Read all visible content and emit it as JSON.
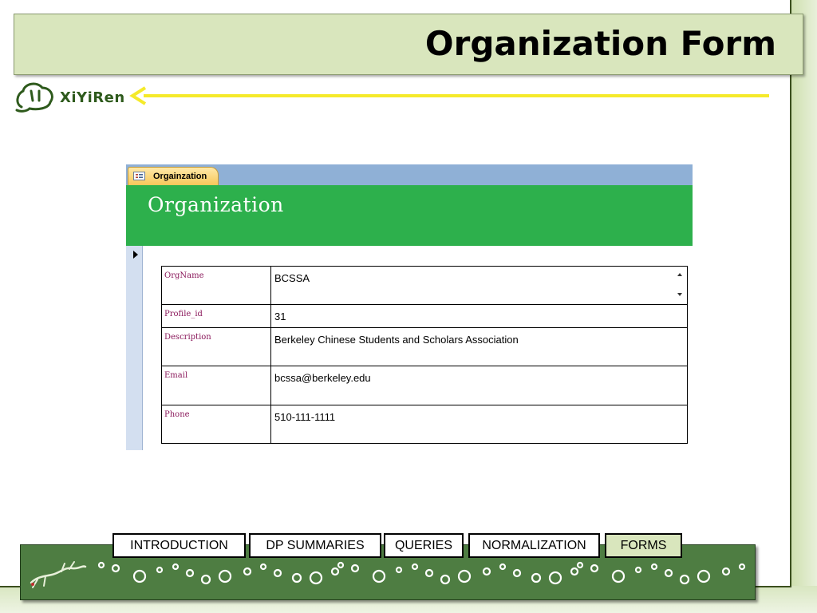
{
  "slide": {
    "title": "Organization Form",
    "logo_text": "XiYiRen"
  },
  "access_form": {
    "tab_label": "Orgainzation",
    "header_title": "Organization",
    "fields": [
      {
        "label": "OrgName",
        "value": "BCSSA"
      },
      {
        "label": "Profile_id",
        "value": "31"
      },
      {
        "label": "Description",
        "value": "Berkeley Chinese Students and Scholars Association"
      },
      {
        "label": "Email",
        "value": "bcssa@berkeley.edu"
      },
      {
        "label": "Phone",
        "value": "510-111-1111"
      }
    ]
  },
  "nav": {
    "items": [
      {
        "label": "INTRODUCTION"
      },
      {
        "label": "DP SUMMARIES"
      },
      {
        "label": "QUERIES"
      },
      {
        "label": "NORMALIZATION"
      },
      {
        "label": "FORMS",
        "active": true
      }
    ]
  },
  "colors": {
    "title_bar": "#d9e6bd",
    "form_header": "#2db04c",
    "footer": "#4e7d42",
    "arrow": "#f5ea2a",
    "field_label": "#8b1a5c"
  }
}
